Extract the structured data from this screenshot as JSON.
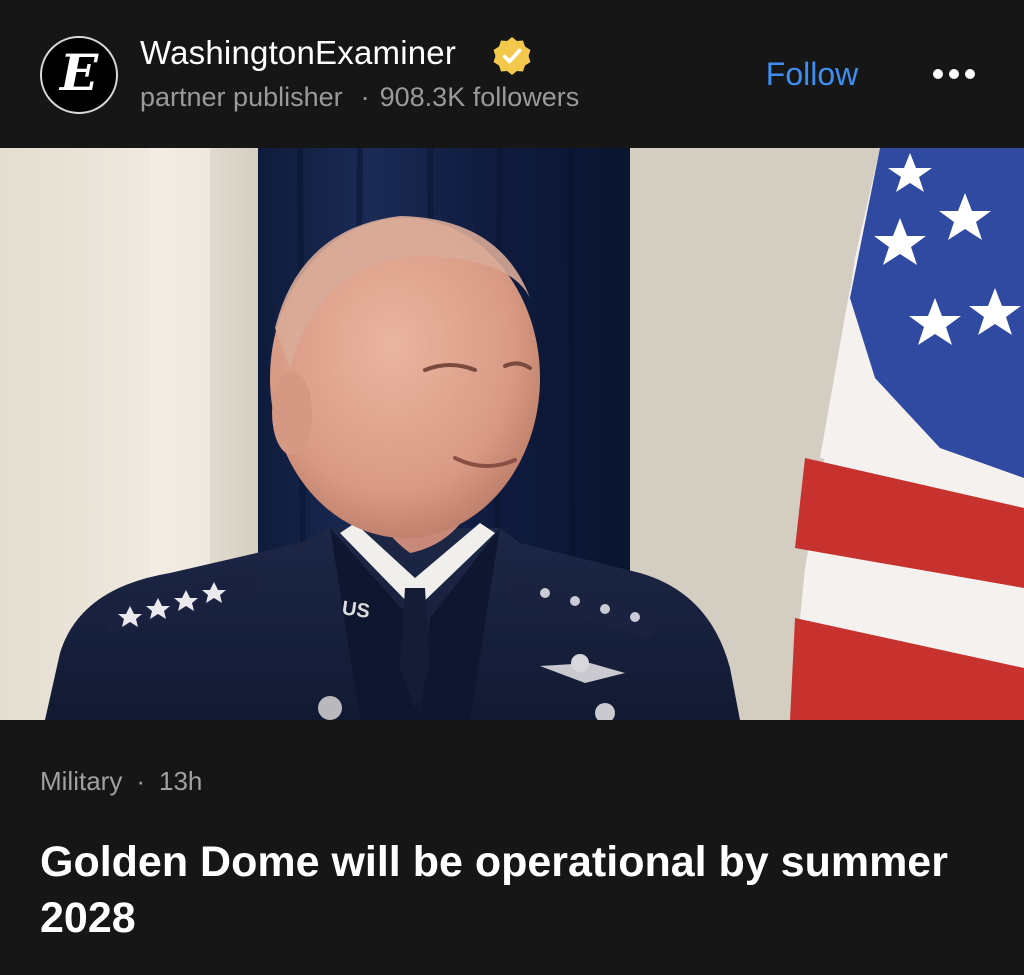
{
  "publisher": {
    "logo_letter": "E",
    "name": "WashingtonExaminer",
    "role": "partner publisher",
    "separator": "·",
    "followers": "908.3K followers",
    "verified_color": "#f2c94c"
  },
  "actions": {
    "follow_label": "Follow",
    "follow_color": "#3d8ef0",
    "more_icon": "more-horizontal-icon"
  },
  "hero_image": {
    "shoulder_label": "US"
  },
  "article": {
    "category": "Military",
    "separator": "·",
    "age": "13h",
    "headline": "Golden Dome will be operational by summer 2028"
  }
}
